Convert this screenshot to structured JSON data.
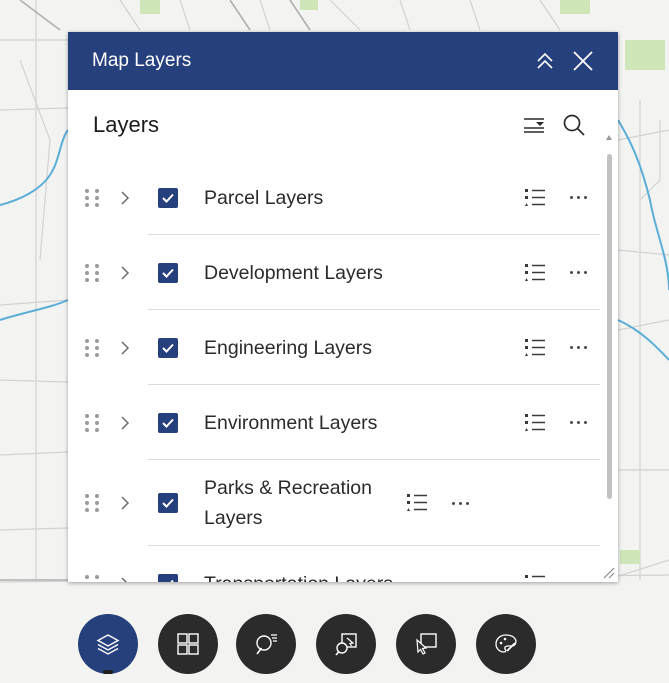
{
  "panel": {
    "title": "Map Layers",
    "layers_title": "Layers"
  },
  "layers": [
    {
      "label": "Parcel Layers",
      "checked": true
    },
    {
      "label": "Development Layers",
      "checked": true
    },
    {
      "label": "Engineering Layers",
      "checked": true
    },
    {
      "label": "Environment Layers",
      "checked": true
    },
    {
      "label": "Parks & Recreation Layers",
      "checked": true
    },
    {
      "label": "Transportation Layers",
      "checked": true
    }
  ],
  "toolbar": {
    "tools": [
      {
        "name": "layers-icon",
        "active": true
      },
      {
        "name": "basemap-gallery-icon",
        "active": false
      },
      {
        "name": "search-query-icon",
        "active": false
      },
      {
        "name": "select-icon",
        "active": false
      },
      {
        "name": "pointer-select-icon",
        "active": false
      },
      {
        "name": "draw-icon",
        "active": false
      }
    ]
  },
  "colors": {
    "header_bg": "#263f7d",
    "checkbox": "#263f7d",
    "tool_bg": "#2b2b2b",
    "tool_active": "#263f7d"
  }
}
